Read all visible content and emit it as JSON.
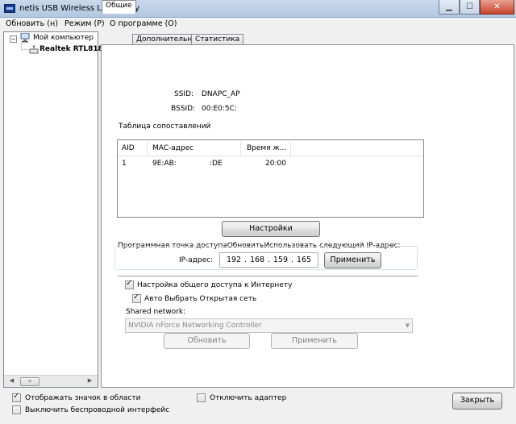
{
  "window": {
    "title": "netis USB Wireless LAN Utility"
  },
  "menu": [
    "Обновить (н)",
    "Режим (P)",
    "О программе (O)"
  ],
  "tree": {
    "root": "Мой компьютер",
    "child": "Realtek RTL818"
  },
  "tabs": [
    "Общие",
    "Дополнительно",
    "Статистика"
  ],
  "general": {
    "ssid_label": "SSID:",
    "ssid_value": "DNAPC_AP",
    "bssid_label": "BSSID:",
    "bssid_value": "00:E0:5C:",
    "table_title": "Таблица сопоставлений",
    "columns": [
      "AID",
      "MAC-адрес",
      "Время ж..."
    ],
    "rows": [
      {
        "aid": "1",
        "mac_start": "9E:AB:",
        "mac_end": ":DE",
        "time": "20:00"
      }
    ],
    "settings_button": "Настройки",
    "ap_group_label": "Программная точка доступаОбновитьИспользовать следующий IP-адрес:",
    "ip_label": "IP-адрес:",
    "ip": [
      "192",
      "168",
      "159",
      "165"
    ],
    "apply_button": "Применить",
    "ics_label": "Настройка общего доступа к Интернету",
    "ics_checked": true,
    "auto_label": "Авто Выбрать Открытая сеть",
    "auto_checked": true,
    "shared_label": "Shared network:",
    "shared_value": "NVIDIA nForce Networking Controller",
    "refresh_button": "Обновить",
    "apply2_button": "Применить"
  },
  "footer": {
    "show_icon_label": "Отображать значок в области",
    "show_icon_checked": true,
    "disable_wireless_label": "Выключить беспроводной интерфейс",
    "disable_wireless_checked": false,
    "disable_adapter_label": "Отключить адаптер",
    "disable_adapter_checked": false,
    "close_button": "Закрыть"
  }
}
